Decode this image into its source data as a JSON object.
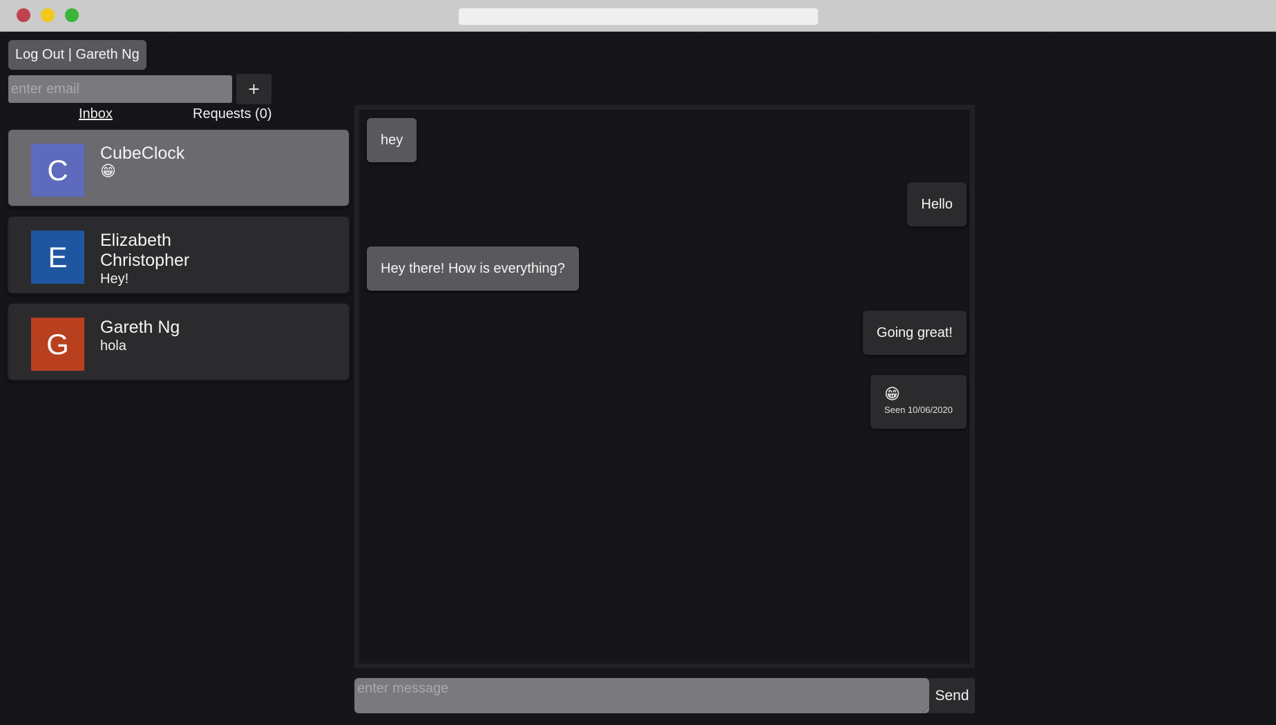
{
  "header": {
    "logout_label": "Log Out | Gareth Ng"
  },
  "add_contact": {
    "email_placeholder": "enter email",
    "add_label": "+"
  },
  "tabs": {
    "inbox": "Inbox",
    "requests": "Requests (0)"
  },
  "conversations": [
    {
      "initial": "C",
      "name": "CubeClock",
      "preview": "😁",
      "avatar_color": "#5e6bbd",
      "active": true
    },
    {
      "initial": "E",
      "name": "Elizabeth Christopher",
      "preview": "Hey!",
      "avatar_color": "#1f56a0",
      "active": false
    },
    {
      "initial": "G",
      "name": "Gareth Ng",
      "preview": "hola",
      "avatar_color": "#b9401f",
      "active": false
    }
  ],
  "messages": [
    {
      "direction": "in",
      "text": "hey"
    },
    {
      "direction": "out",
      "text": "Hello"
    },
    {
      "direction": "in",
      "text": "Hey there! How is everything?"
    },
    {
      "direction": "out",
      "text": "Going great!"
    },
    {
      "direction": "out",
      "text": "😁",
      "seen": "Seen 10/06/2020"
    }
  ],
  "composer": {
    "placeholder": "enter message",
    "send_label": "Send"
  },
  "colors": {
    "background": "#161519",
    "incoming_bubble": "#59585c",
    "outgoing_bubble": "#2b2b2e",
    "active_conversation": "#6b6a6e"
  }
}
